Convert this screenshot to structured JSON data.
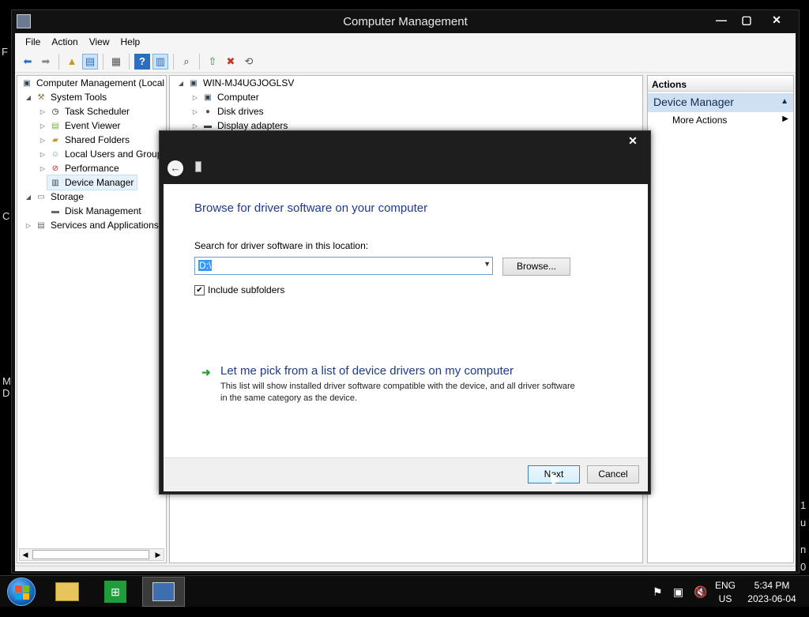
{
  "window": {
    "title": "Computer Management",
    "controls": {
      "minimize": "—",
      "maximize": "▢",
      "close": "✕"
    }
  },
  "desktop_fragments": [
    "F",
    "C",
    "M",
    "D",
    "1",
    "u",
    "n",
    "0"
  ],
  "menu": [
    "File",
    "Action",
    "View",
    "Help"
  ],
  "toolbar_icons": [
    "back-arrow-icon",
    "forward-arrow-icon",
    "up-folder-icon",
    "show-hide-console-tree-icon",
    "properties-icon",
    "help-icon",
    "show-hide-action-pane-icon",
    "scan-hardware-icon",
    "update-driver-icon",
    "disable-device-icon",
    "uninstall-device-icon"
  ],
  "tree": {
    "root": "Computer Management (Local",
    "system_tools": "System Tools",
    "task_scheduler": "Task Scheduler",
    "event_viewer": "Event Viewer",
    "shared_folders": "Shared Folders",
    "local_users": "Local Users and Group",
    "performance": "Performance",
    "device_manager": "Device Manager",
    "storage": "Storage",
    "disk_management": "Disk Management",
    "services": "Services and Applications"
  },
  "devices": {
    "host": "WIN-MJ4UGJOGLSV",
    "items": [
      "Computer",
      "Disk drives",
      "Display adapters"
    ]
  },
  "actions": {
    "header": "Actions",
    "section": "Device Manager",
    "more": "More Actions"
  },
  "dialog": {
    "close": "✕",
    "back": "←",
    "heading": "Browse for driver software on your computer",
    "search_label": "Search for driver software in this location:",
    "path_value": "D:\\",
    "browse": "Browse...",
    "include_subfolders": "Include subfolders",
    "include_checked": true,
    "pick_title": "Let me pick from a list of device drivers on my computer",
    "pick_desc": "This list will show installed driver software compatible with the device, and all driver software in the same category as the device.",
    "next": "Next",
    "cancel": "Cancel"
  },
  "taskbar": {
    "lang": "ENG",
    "region": "US",
    "time": "5:34 PM",
    "date": "2023-06-04"
  },
  "colors": {
    "accent": "#1e3a8a",
    "selection": "#3399ff",
    "action_section": "#cfe0f3"
  }
}
